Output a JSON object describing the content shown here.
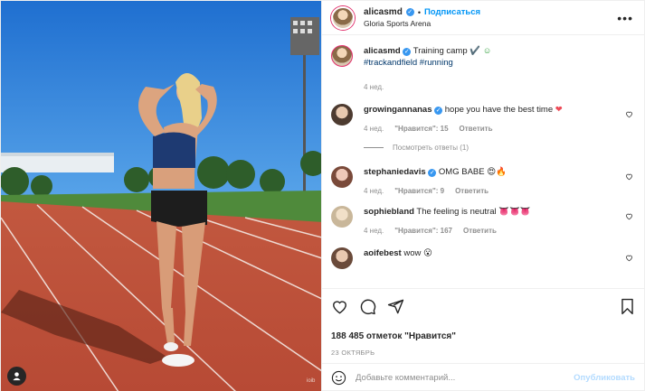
{
  "header": {
    "username": "alicasmd",
    "follow_label": "Подписаться",
    "location": "Gloria Sports Arena",
    "more_icon": "more-icon"
  },
  "caption": {
    "username": "alicasmd",
    "text": "Training camp",
    "emojis": "✔️ ☺",
    "tags": "#trackandfield #running",
    "time": "4 нед."
  },
  "comments": [
    {
      "username": "growingannanas",
      "verified": true,
      "text": "hope you have the best time",
      "emoji": "❤",
      "time": "4 нед.",
      "likes": "\"Нравится\": 15",
      "reply": "Ответить",
      "view_replies": "Посмотреть ответы (1)"
    },
    {
      "username": "stephaniedavis",
      "verified": true,
      "text": "OMG BABE",
      "emoji": "😍🔥",
      "time": "4 нед.",
      "likes": "\"Нравится\": 9",
      "reply": "Ответить"
    },
    {
      "username": "sophiebland",
      "verified": false,
      "text": "The feeling is neutral",
      "emoji": "👅👅👅",
      "time": "4 нед.",
      "likes": "\"Нравится\": 167",
      "reply": "Ответить"
    },
    {
      "username": "aoifebest",
      "verified": false,
      "text": "wow",
      "emoji": "😮",
      "time": "",
      "likes": "",
      "reply": ""
    }
  ],
  "likes_text": "188 485 отметок \"Нравится\"",
  "date_text": "23 ОКТЯБРЬ",
  "add_comment": {
    "placeholder": "Добавьте комментарий...",
    "publish": "Опубликовать"
  },
  "photo": {
    "description_icon": "user-tag-icon",
    "watermark": "ioib"
  },
  "colors": {
    "accent": "#0095f6",
    "verified": "#3897f0",
    "heart": "#ed4956",
    "muted": "#8e8e8e",
    "track": "#c8553d",
    "sky": "#2f7fd8"
  }
}
